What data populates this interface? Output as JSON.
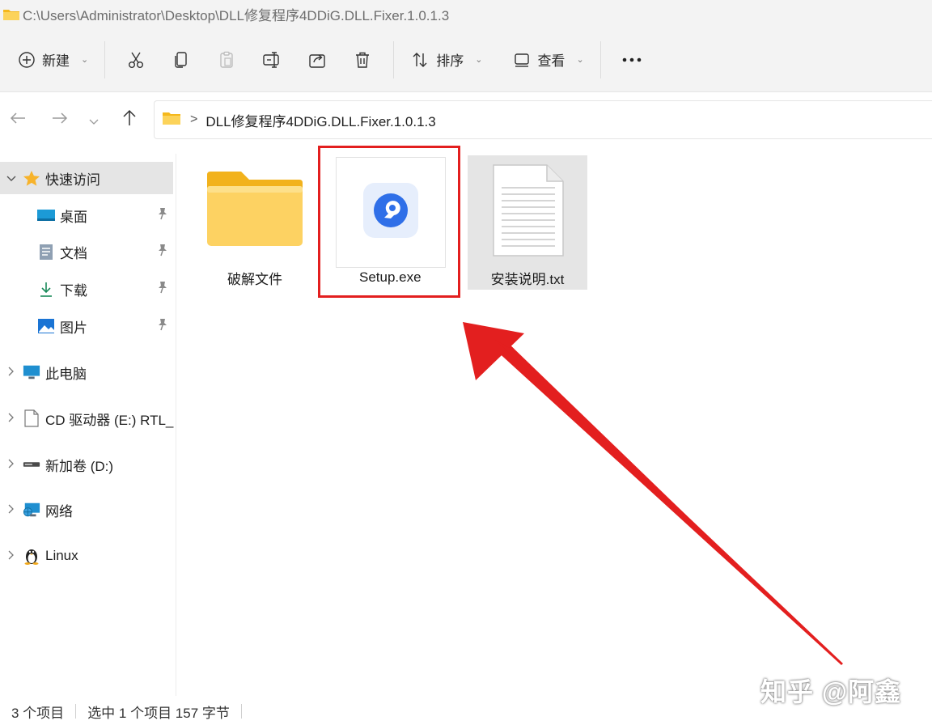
{
  "window": {
    "title_path": "C:\\Users\\Administrator\\Desktop\\DLL修复程序4DDiG.DLL.Fixer.1.0.1.3"
  },
  "toolbar": {
    "new_label": "新建",
    "sort_label": "排序",
    "view_label": "查看",
    "icons": [
      "plus-circle-icon",
      "cut-icon",
      "copy-icon",
      "paste-icon",
      "rename-icon",
      "share-icon",
      "delete-icon",
      "sort-icon",
      "view-icon",
      "more-icon"
    ]
  },
  "address": {
    "folder_name": "DLL修复程序4DDiG.DLL.Fixer.1.0.1.3",
    "separator": ">"
  },
  "sidebar": {
    "items": [
      {
        "label": "快速访问",
        "icon": "star-icon"
      },
      {
        "label": "桌面",
        "icon": "desktop-icon"
      },
      {
        "label": "文档",
        "icon": "document-icon"
      },
      {
        "label": "下载",
        "icon": "download-icon"
      },
      {
        "label": "图片",
        "icon": "picture-icon"
      },
      {
        "label": "此电脑",
        "icon": "pc-icon"
      },
      {
        "label": "CD 驱动器 (E:) RTL_",
        "icon": "cd-drive-icon"
      },
      {
        "label": "新加卷 (D:)",
        "icon": "drive-icon"
      },
      {
        "label": "网络",
        "icon": "network-icon"
      },
      {
        "label": "Linux",
        "icon": "linux-icon"
      }
    ]
  },
  "files": [
    {
      "name": "破解文件",
      "type": "folder"
    },
    {
      "name": "Setup.exe",
      "type": "exe",
      "highlighted": true
    },
    {
      "name": "安装说明.txt",
      "type": "txt",
      "selected": true
    }
  ],
  "status": {
    "item_count": "3 个项目",
    "selection": "选中 1 个项目  157 字节"
  },
  "watermark": "知乎 @阿鑫",
  "colors": {
    "highlight": "#e31f1f",
    "arrow": "#e31f1f",
    "folder": "#f7c74b",
    "app_icon": "#2f6fe8"
  }
}
